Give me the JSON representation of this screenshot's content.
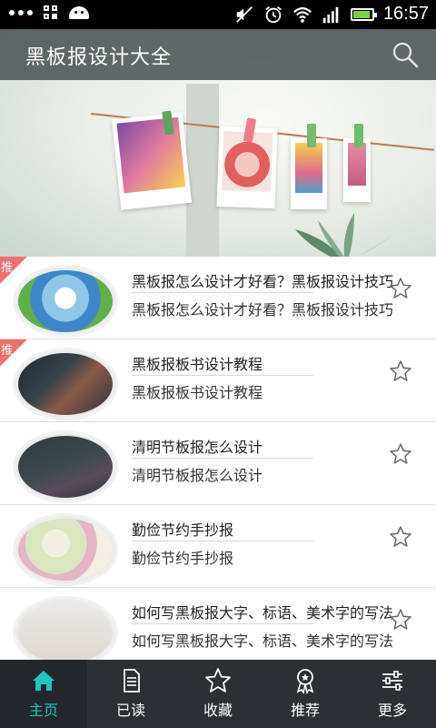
{
  "status_bar": {
    "time": "16:57"
  },
  "app_bar": {
    "title": "黑板报设计大全"
  },
  "list": {
    "badge": "推",
    "items": [
      {
        "title": "黑板报怎么设计才好看？黑板报设计技巧",
        "desc": "黑板报怎么设计才好看？黑板报设计技巧",
        "recommended": true
      },
      {
        "title": "黑板报板书设计教程",
        "desc": "黑板报板书设计教程",
        "recommended": true
      },
      {
        "title": "清明节板报怎么设计",
        "desc": "清明节板报怎么设计",
        "recommended": false
      },
      {
        "title": "勤俭节约手抄报",
        "desc": "勤俭节约手抄报",
        "recommended": false
      },
      {
        "title": "如何写黑板报大字、标语、美术字的写法",
        "desc": "如何写黑板报大字、标语、美术字的写法",
        "recommended": false
      }
    ]
  },
  "bottom_nav": {
    "items": [
      {
        "label": "主页",
        "icon": "home-icon",
        "active": true
      },
      {
        "label": "已读",
        "icon": "document-icon",
        "active": false
      },
      {
        "label": "收藏",
        "icon": "star-icon",
        "active": false
      },
      {
        "label": "推荐",
        "icon": "badge-icon",
        "active": false
      },
      {
        "label": "更多",
        "icon": "sliders-icon",
        "active": false
      }
    ]
  },
  "colors": {
    "accent": "#1ec7c0",
    "badge": "#f06e6e",
    "nav_bg": "#2c2f33",
    "app_bar": "#465050"
  }
}
